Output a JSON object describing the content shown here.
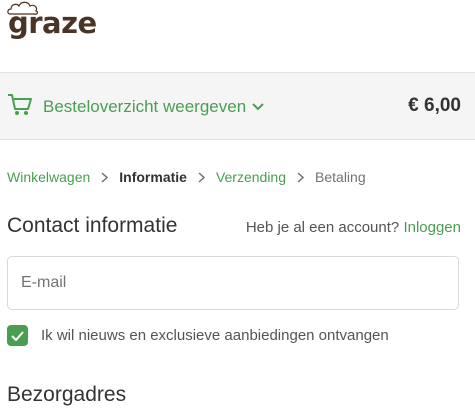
{
  "brand": {
    "logo_text": "graze"
  },
  "summary": {
    "toggle_label": "Besteloverzicht weergeven",
    "total": "€ 6,00"
  },
  "breadcrumb": {
    "items": [
      "Winkelwagen",
      "Informatie",
      "Verzending",
      "Betaling"
    ]
  },
  "contact": {
    "title": "Contact informatie",
    "account_prompt": "Heb je al een account?",
    "login_label": "Inloggen",
    "email_placeholder": "E-mail",
    "email_value": "",
    "newsletter_label": "Ik wil nieuws en exclusieve aanbiedingen ontvangen",
    "newsletter_checked": true
  },
  "shipping": {
    "title": "Bezorgadres"
  },
  "colors": {
    "accent": "#4a9e52",
    "brand": "#4a3426",
    "summary_background": "#f5f5f5"
  },
  "icons": [
    "cloud-logo-icon",
    "cart-icon",
    "chevron-down-icon",
    "chevron-right-icon",
    "checkmark-icon"
  ]
}
